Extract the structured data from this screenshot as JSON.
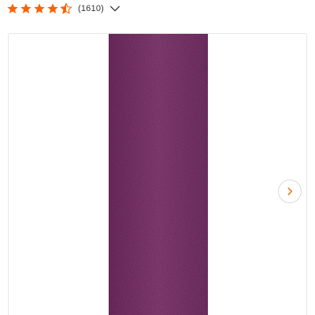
{
  "rating": {
    "value": 4.5,
    "max": 5,
    "review_count": "(1610)",
    "star_color": "#f96302",
    "icon": "star-icon"
  },
  "toggle": {
    "icon": "chevron-down-icon"
  },
  "gallery": {
    "product_color": "#8e3f7e",
    "next_icon": "chevron-right-icon",
    "accent": "#f96302"
  }
}
